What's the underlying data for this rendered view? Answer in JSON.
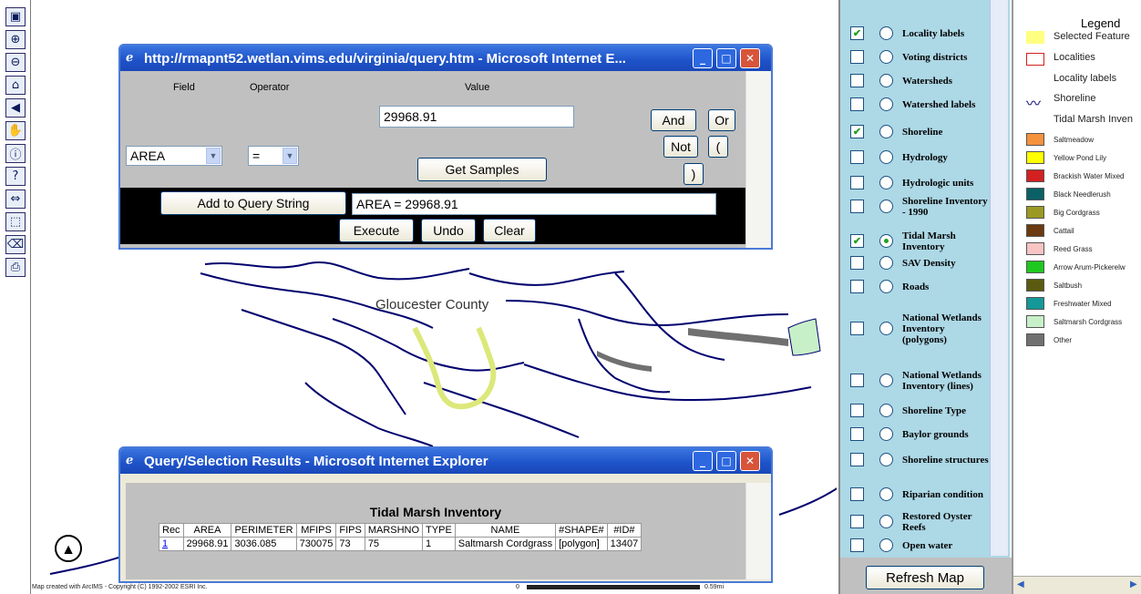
{
  "toolbar": {
    "tools": [
      "toggle-overview-icon",
      "zoom-in-icon",
      "zoom-out-icon",
      "full-extent-icon",
      "back-arrow-icon",
      "pan-hand-icon",
      "identify-icon",
      "query-icon",
      "measure-icon",
      "select-rect-icon",
      "clear-eraser-icon",
      "print-icon"
    ],
    "glyphs": [
      "▣",
      "⊕",
      "⊖",
      "⌂",
      "◀",
      "✋",
      "ⓘ",
      "?",
      "⇔",
      "⬚",
      "⌫",
      "⎙"
    ]
  },
  "map": {
    "county_label": "Gloucester County",
    "copyright": "Map created with ArcIMS - Copyright (C) 1992-2002 ESRI Inc.",
    "scale_start": "0",
    "scale_end": "0.59mi",
    "north_arrow": "▲"
  },
  "query_window": {
    "title": "http://rmapnt52.wetlan.vims.edu/virginia/query.htm - Microsoft Internet E...",
    "field_header": "Field",
    "operator_header": "Operator",
    "value_header": "Value",
    "field_value": "AREA",
    "operator_value": "=",
    "value_input": "29968.91",
    "get_samples": "Get Samples",
    "and": "And",
    "or": "Or",
    "not": "Not",
    "lparen": "(",
    "rparen": ")",
    "add_query": "Add to Query String",
    "query_string": "AREA  =  29968.91",
    "execute": "Execute",
    "undo": "Undo",
    "clear": "Clear"
  },
  "results_window": {
    "title": "Query/Selection Results - Microsoft Internet Explorer",
    "table_title": "Tidal Marsh Inventory",
    "headers": [
      "Rec",
      "AREA",
      "PERIMETER",
      "MFIPS",
      "FIPS",
      "MARSHNO",
      "TYPE",
      "NAME",
      "#SHAPE#",
      "#ID#"
    ],
    "row": [
      "1",
      "29968.91",
      "3036.085",
      "730075",
      "73",
      "75",
      "1",
      "Saltmarsh Cordgrass",
      "[polygon]",
      "13407"
    ]
  },
  "layers": {
    "items": [
      {
        "label": "Locality labels",
        "checked": true,
        "active": false
      },
      {
        "label": "Voting districts",
        "checked": false,
        "active": false
      },
      {
        "label": "Watersheds",
        "checked": false,
        "active": false
      },
      {
        "label": "Watershed labels",
        "checked": false,
        "active": false
      },
      {
        "label": "Shoreline",
        "checked": true,
        "active": false
      },
      {
        "label": "Hydrology",
        "checked": false,
        "active": false
      },
      {
        "label": "Hydrologic units",
        "checked": false,
        "active": false
      },
      {
        "label": "Shoreline Inventory - 1990",
        "checked": false,
        "active": false
      },
      {
        "label": "Tidal Marsh Inventory",
        "checked": true,
        "active": true
      },
      {
        "label": "SAV Density",
        "checked": false,
        "active": false
      },
      {
        "label": "Roads",
        "checked": false,
        "active": false
      },
      {
        "label": "National Wetlands Inventory (polygons)",
        "checked": false,
        "active": false
      },
      {
        "label": "National Wetlands Inventory (lines)",
        "checked": false,
        "active": false
      },
      {
        "label": "Shoreline Type",
        "checked": false,
        "active": false
      },
      {
        "label": "Baylor grounds",
        "checked": false,
        "active": false
      },
      {
        "label": "Shoreline structures",
        "checked": false,
        "active": false
      },
      {
        "label": "Riparian condition",
        "checked": false,
        "active": false
      },
      {
        "label": "Restored Oyster Reefs",
        "checked": false,
        "active": false
      },
      {
        "label": "Open water",
        "checked": false,
        "active": false
      }
    ],
    "refresh": "Refresh Map"
  },
  "legend": {
    "title": "Legend",
    "selected": "Selected Feature",
    "localities": "Localities",
    "locality_labels": "Locality labels",
    "shoreline": "Shoreline",
    "tidal": "Tidal Marsh Inven",
    "classes": [
      {
        "name": "Saltmeadow",
        "color": "#f5923e"
      },
      {
        "name": "Yellow Pond Lily",
        "color": "#ffff00"
      },
      {
        "name": "Brackish Water Mixed",
        "color": "#d42020"
      },
      {
        "name": "Black Needlerush",
        "color": "#0a6066"
      },
      {
        "name": "Big Cordgrass",
        "color": "#9a9a22"
      },
      {
        "name": "Cattail",
        "color": "#6b3a10"
      },
      {
        "name": "Reed Grass",
        "color": "#f8c4c4"
      },
      {
        "name": "Arrow Arum-Pickerelw",
        "color": "#1ec81e"
      },
      {
        "name": "Saltbush",
        "color": "#5a5a10"
      },
      {
        "name": "Freshwater Mixed",
        "color": "#149898"
      },
      {
        "name": "Saltmarsh Cordgrass",
        "color": "#c8f0c8"
      },
      {
        "name": "Other",
        "color": "#707070"
      }
    ]
  }
}
